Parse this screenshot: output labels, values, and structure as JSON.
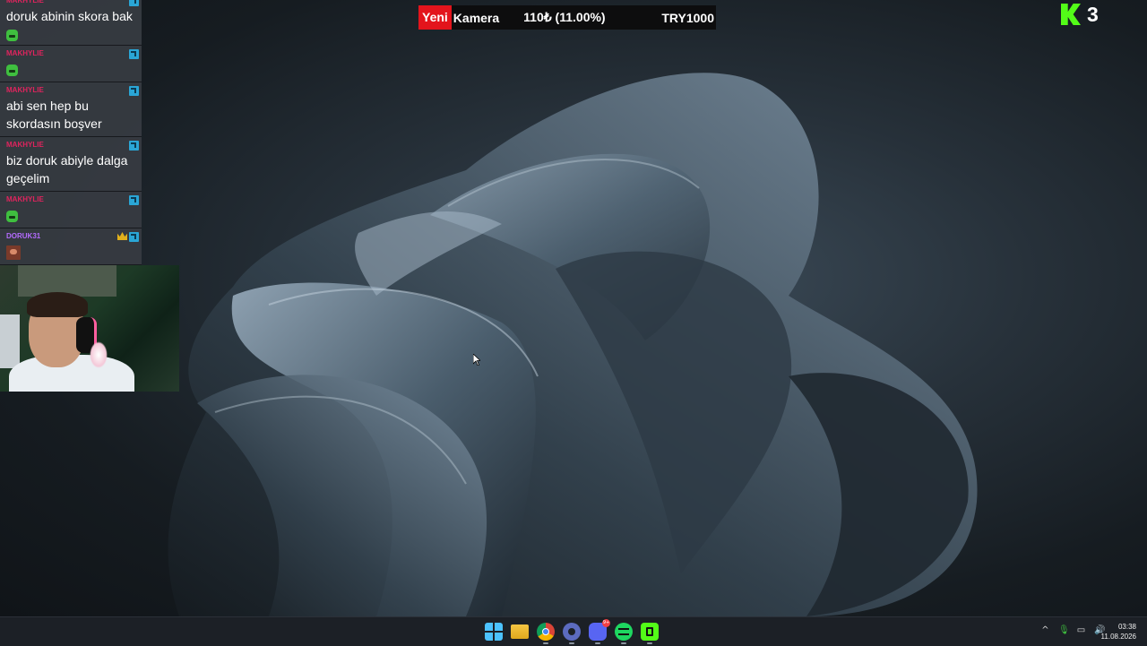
{
  "overlay": {
    "top_bar": {
      "label_red": "Yeni",
      "label_name": "Kamera",
      "amount": "110₺ (11.00%)",
      "goal": "TRY1000"
    },
    "logo_number": "3"
  },
  "chat": {
    "messages": [
      {
        "user": "MAKHYLIE",
        "text": "doruk abinin skora bak"
      },
      {
        "user": "MAKHYLIE",
        "text": ""
      },
      {
        "user": "MAKHYLIE",
        "text": "abi sen hep bu skordasın boşver"
      },
      {
        "user": "MAKHYLIE",
        "text": "biz doruk abiyle dalga geçelim"
      },
      {
        "user": "MAKHYLIE",
        "text": ""
      },
      {
        "user": "DORUK31",
        "text": ""
      }
    ]
  },
  "taskbar": {
    "apps": [
      "windows-start-icon",
      "file-explorer-icon",
      "chrome-icon",
      "settings-icon",
      "discord-icon",
      "spotify-icon",
      "kick-icon"
    ],
    "discord_badge": "9+",
    "tray_up": "^",
    "time": "03:38",
    "date": "11.08.2026"
  },
  "colors": {
    "alert_red": "#e3141c",
    "kick_green": "#53fc18",
    "username_pink": "#e0245e",
    "username_violet": "#b46cff"
  }
}
